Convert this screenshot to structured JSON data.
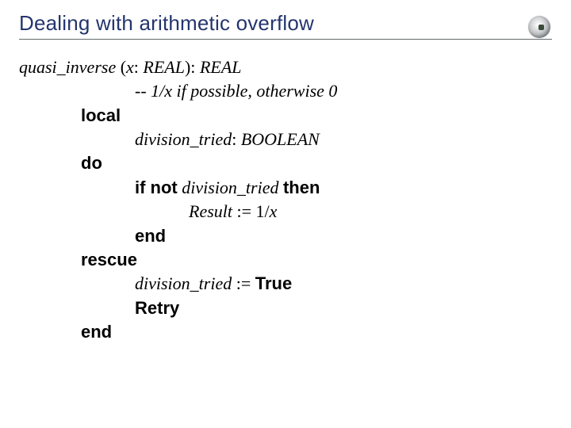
{
  "title": "Dealing with arithmetic overflow",
  "logo_name": "sphere-logo",
  "code": {
    "fn_name": "quasi_inverse",
    "sig_open": " (",
    "param": "x",
    "colon1": ": ",
    "type1": "REAL",
    "sig_close": "): ",
    "ret_type": "REAL",
    "comment": "-- 1/x if possible, otherwise 0",
    "kw_local": "local",
    "var_name": "division_tried",
    "var_colon": ": ",
    "var_type": "BOOLEAN",
    "kw_do": "do",
    "kw_if": "if not",
    "cond_var": " division_tried ",
    "kw_then": "then",
    "result": "Result",
    "assign1": " := 1/",
    "assign_rhs": "x",
    "kw_end1": "end",
    "kw_rescue": "rescue",
    "rescue_var": "division_tried",
    "assign2": " := ",
    "true_val": "True",
    "retry": "Retry",
    "kw_end2": "end"
  }
}
